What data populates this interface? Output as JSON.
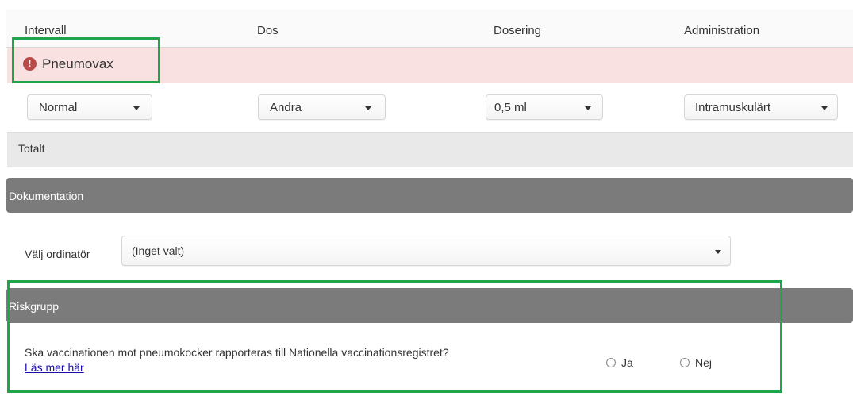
{
  "table": {
    "headers": [
      "Intervall",
      "Dos",
      "Dosering",
      "Administration"
    ],
    "vaccine_name": "Pneumovax",
    "alert_icon": "!",
    "dropdowns": {
      "intervall": "Normal",
      "dos": "Andra",
      "dosering": "0,5 ml",
      "administration": "Intramuskulärt"
    },
    "total_label": "Totalt"
  },
  "documentation": {
    "title": "Dokumentation",
    "ordinator_label": "Välj ordinatör",
    "ordinator_value": "(Inget valt)"
  },
  "riskgroup": {
    "title": "Riskgrupp",
    "question": "Ska vaccinationen mot pneumokocker rapporteras till Nationella vaccinationsregistret?",
    "link": "Läs mer här",
    "options": [
      "Ja",
      "Nej"
    ]
  },
  "colors": {
    "highlight": "#21a54b",
    "alert": "#b94a48",
    "pink_row": "#f9e1e1",
    "section_header": "#7b7b7b",
    "link": "#1a0dab"
  }
}
